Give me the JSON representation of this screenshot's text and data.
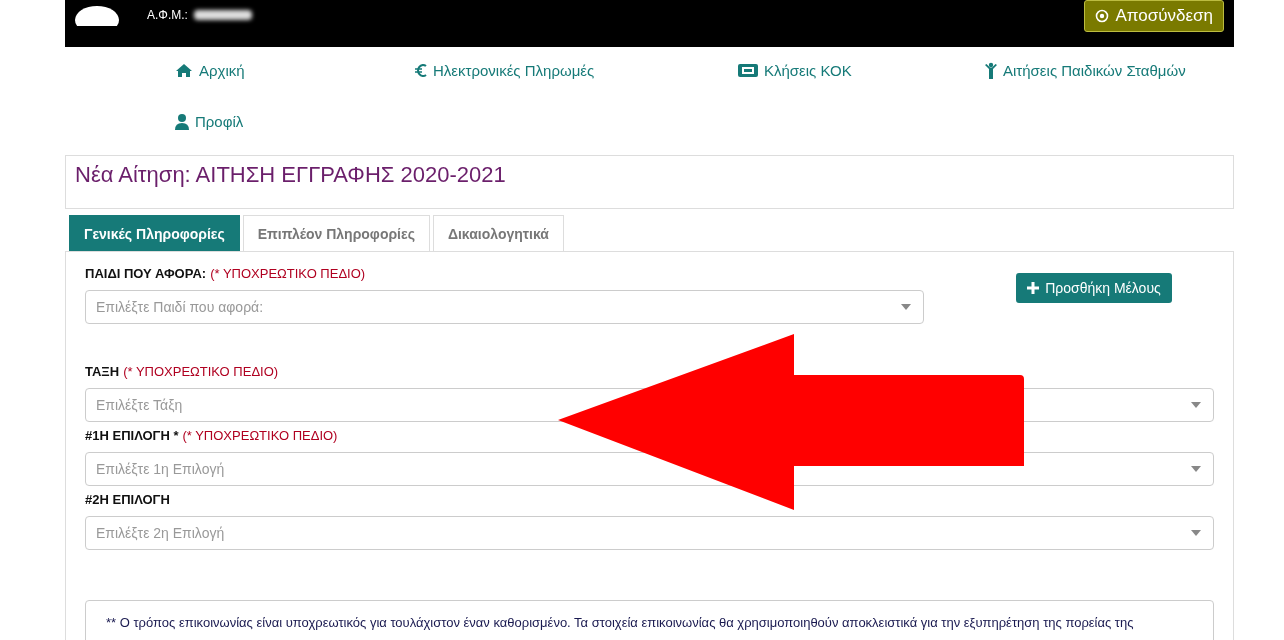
{
  "header": {
    "user_label": "Α.Φ.Μ.:",
    "logout_button": "Αποσύνδεση"
  },
  "nav": [
    {
      "label": "Αρχική",
      "kind": "home"
    },
    {
      "label": "Ηλεκτρονικές Πληρωμές",
      "kind": "payments"
    },
    {
      "label": "Κλήσεις ΚΟΚ",
      "kind": "tickets"
    },
    {
      "label": "Αιτήσεις Παιδικών Σταθμών",
      "kind": "nursery"
    },
    {
      "label": "Προφίλ",
      "kind": "profile"
    }
  ],
  "page_title": "Νέα Αίτηση: ΑΙΤΗΣΗ ΕΓΓΡΑΦΗΣ 2020-2021",
  "tabs": [
    {
      "label": "Γενικές Πληροφορίες",
      "selected": true
    },
    {
      "label": "Επιπλέον Πληροφορίες",
      "selected": false
    },
    {
      "label": "Δικαιολογητικά",
      "selected": false
    }
  ],
  "add_member_button": "Προσθήκη Μέλους",
  "fields": [
    {
      "label": "ΠΑΙΔΙ ΠΟΥ ΑΦΟΡΑ:",
      "required_note": "(* ΥΠΟΧΡΕΩΤΙΚΟ ΠΕΔΙΟ)",
      "placeholder": "Επιλέξτε Παιδί που αφορά:"
    },
    {
      "label": "ΤΑΞΗ",
      "required_note": "(* ΥΠΟΧΡΕΩΤΙΚΟ ΠΕΔΙΟ)",
      "placeholder": "Επιλέξτε Τάξη"
    },
    {
      "label": "#1Η ΕΠΙΛΟΓΗ *",
      "required_note": "(* ΥΠΟΧΡΕΩΤΙΚΟ ΠΕΔΙΟ)",
      "placeholder": "Επιλέξτε 1η Επιλογή"
    },
    {
      "label": "#2Η ΕΠΙΛΟΓΗ",
      "placeholder": "Επιλέξτε 2η Επιλογή"
    }
  ],
  "note": "** Ο τρόπος επικοινωνίας είναι υποχρεωτικός για τουλάχιστον έναν καθορισμένο. Τα στοιχεία επικοινωνίας θα χρησιμοποιηθούν αποκλειστικά για την εξυπηρέτηση της πορείας της"
}
